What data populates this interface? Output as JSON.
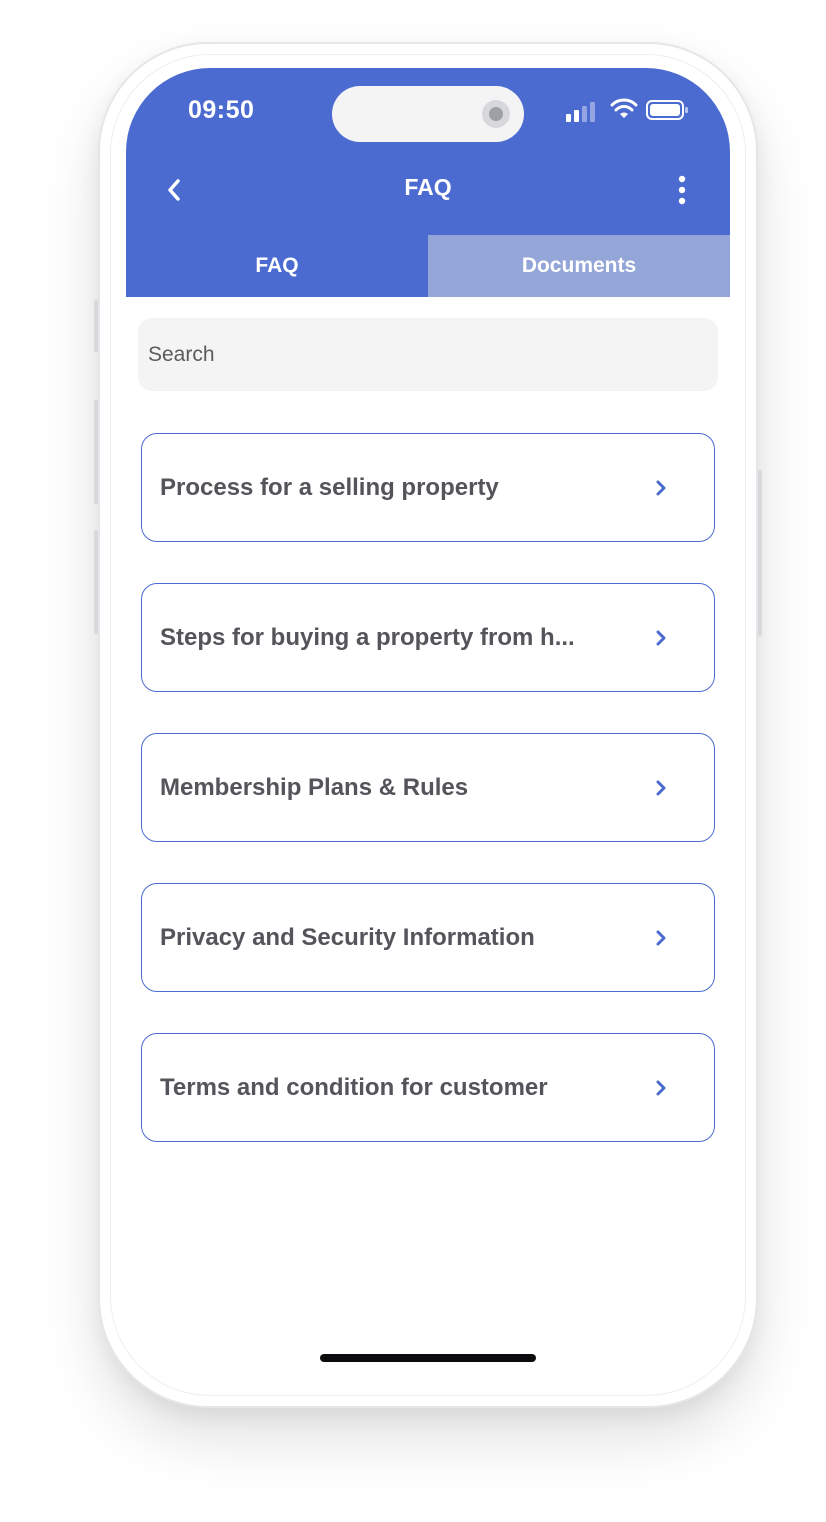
{
  "status_bar": {
    "time": "09:50",
    "icons": [
      "cellular-signal-icon",
      "wifi-icon",
      "battery-icon"
    ]
  },
  "header": {
    "title": "FAQ",
    "back_icon": "chevron-left-icon",
    "menu_icon": "more-vertical-icon"
  },
  "tabs": [
    {
      "label": "FAQ",
      "active": true
    },
    {
      "label": "Documents",
      "active": false
    }
  ],
  "search": {
    "placeholder": "Search",
    "value": ""
  },
  "faq_items": [
    {
      "label": "Process for a selling property"
    },
    {
      "label": "Steps for buying a property from h..."
    },
    {
      "label": "Membership Plans & Rules"
    },
    {
      "label": "Privacy and Security Information"
    },
    {
      "label": "Terms and condition for customer"
    }
  ],
  "colors": {
    "primary": "#4b6bd1",
    "tab_inactive": "#94a6d8",
    "item_text": "#54545a",
    "search_bg": "#f4f4f5"
  }
}
